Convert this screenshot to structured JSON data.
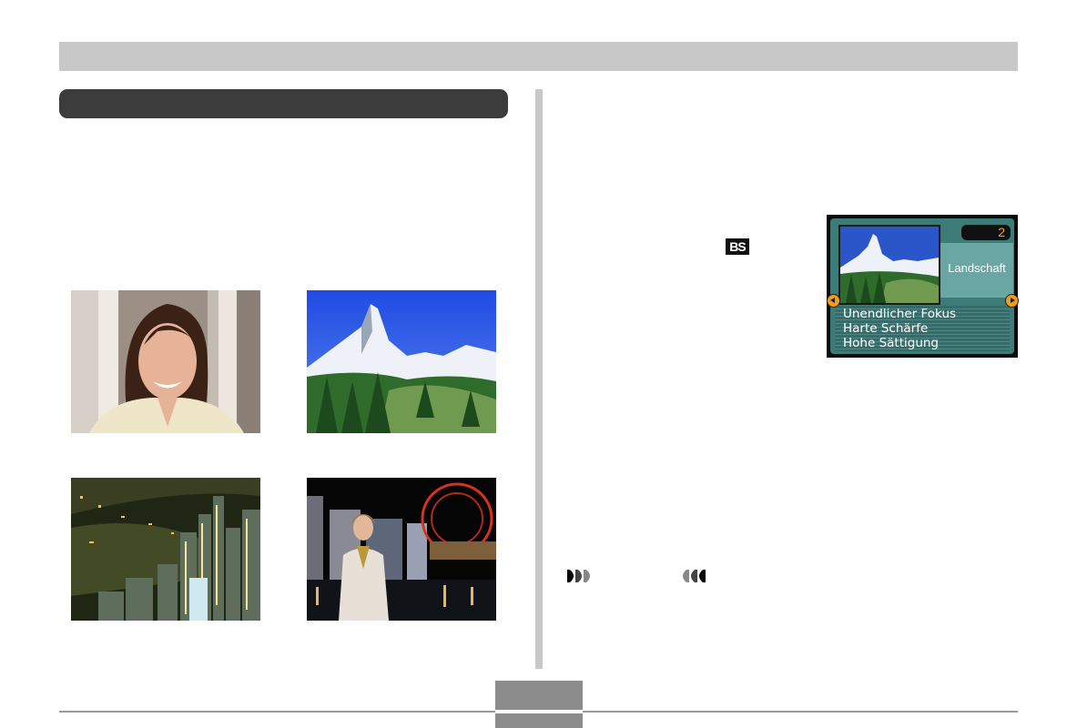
{
  "lcd": {
    "scene_number": "2",
    "scene_name": "Landschaft",
    "settings": [
      "Unendlicher Fokus",
      "Harte Schärfe",
      "Hohe Sättigung"
    ]
  },
  "icons": {
    "bs_mode": "BS",
    "nav_next": "forward-arrows-icon",
    "nav_prev": "back-arrows-icon"
  },
  "colors": {
    "lcd_background": "#3c7b78",
    "lcd_number": "#f7a21c",
    "bars": "#c8c8c8",
    "section_bar": "#3c3c3c"
  },
  "photos": [
    "portrait",
    "landscape",
    "night-scene",
    "night-scene-portrait"
  ]
}
